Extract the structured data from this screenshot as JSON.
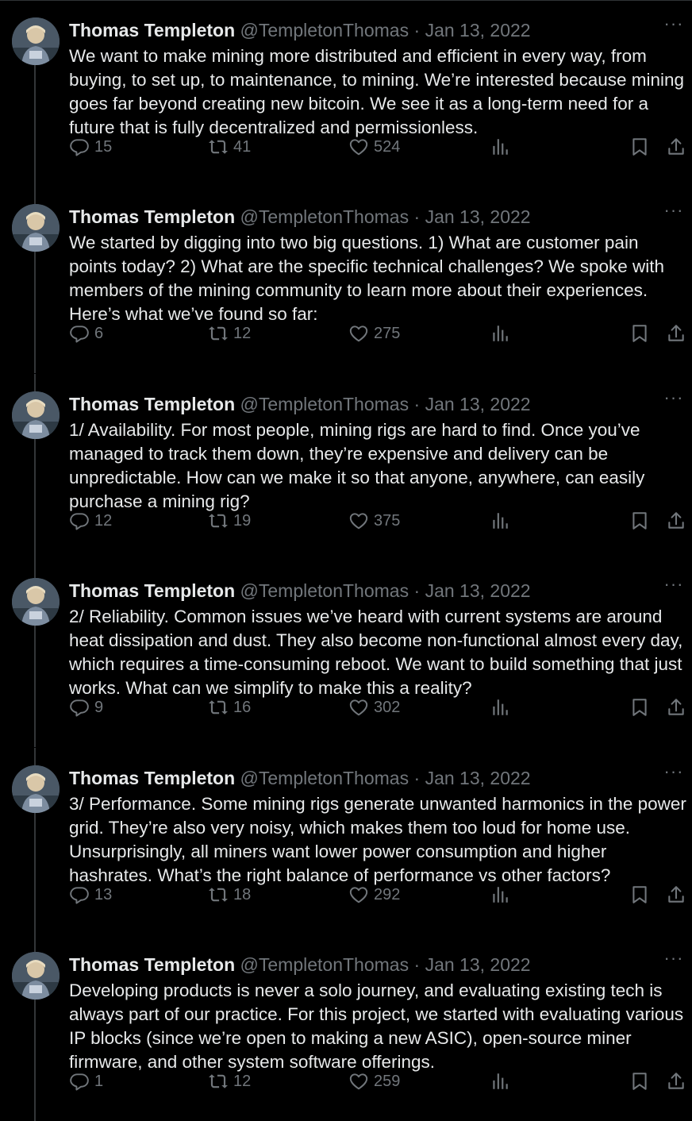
{
  "colors": {
    "background": "#000000",
    "text": "#e7e9ea",
    "muted": "#71767b",
    "thread_line": "#333639"
  },
  "icons": {
    "reply": "reply-icon",
    "retweet": "retweet-icon",
    "like": "heart-icon",
    "views": "views-icon",
    "bookmark": "bookmark-icon",
    "share": "share-icon",
    "more": "more-icon"
  },
  "tweets": [
    {
      "name": "Thomas Templeton",
      "handle": "@TempletonThomas",
      "separator": "·",
      "date": "Jan 13, 2022",
      "more": "···",
      "text": "We want to make mining more distributed and efficient in every way, from buying, to set up, to maintenance, to mining. We’re interested because mining goes far beyond creating new bitcoin. We see it as a long-term need for a future that is fully decentralized and permissionless.",
      "replies": "15",
      "retweets": "41",
      "likes": "524"
    },
    {
      "name": "Thomas Templeton",
      "handle": "@TempletonThomas",
      "separator": "·",
      "date": "Jan 13, 2022",
      "more": "···",
      "text": "We started by digging into two big questions. 1) What are customer pain points today? 2) What are the specific technical challenges? We spoke with members of the mining community to learn more about their experiences. Here’s what we’ve found so far:",
      "replies": "6",
      "retweets": "12",
      "likes": "275"
    },
    {
      "name": "Thomas Templeton",
      "handle": "@TempletonThomas",
      "separator": "·",
      "date": "Jan 13, 2022",
      "more": "···",
      "text": "1/ Availability. For most people, mining rigs are hard to find. Once you’ve managed to track them down, they’re expensive and delivery can be unpredictable. How can we make it so that anyone, anywhere, can easily purchase a mining rig?",
      "replies": "12",
      "retweets": "19",
      "likes": "375"
    },
    {
      "name": "Thomas Templeton",
      "handle": "@TempletonThomas",
      "separator": "·",
      "date": "Jan 13, 2022",
      "more": "···",
      "text": "2/ Reliability. Common issues we’ve heard with current systems are around heat dissipation and dust. They also become non-functional almost every day, which requires a time-consuming reboot. We want to build something that just works. What can we simplify to make this a reality?",
      "replies": "9",
      "retweets": "16",
      "likes": "302"
    },
    {
      "name": "Thomas Templeton",
      "handle": "@TempletonThomas",
      "separator": "·",
      "date": "Jan 13, 2022",
      "more": "···",
      "text": "3/ Performance. Some mining rigs generate unwanted harmonics in the power grid. They’re also very noisy, which makes them too loud for home use. Unsurprisingly, all miners want lower power consumption and higher hashrates. What’s the right balance of performance vs other factors?",
      "replies": "13",
      "retweets": "18",
      "likes": "292"
    },
    {
      "name": "Thomas Templeton",
      "handle": "@TempletonThomas",
      "separator": "·",
      "date": "Jan 13, 2022",
      "more": "···",
      "text": "Developing products is never a solo journey, and evaluating existing tech is always part of our practice. For this project, we started with evaluating various IP blocks (since we’re open to making a new ASIC), open-source miner firmware, and other system software offerings.",
      "replies": "1",
      "retweets": "12",
      "likes": "259"
    }
  ]
}
